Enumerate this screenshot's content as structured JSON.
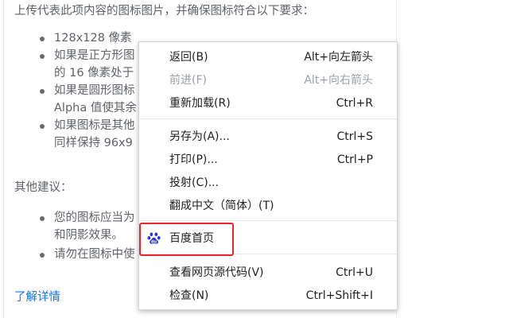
{
  "content": {
    "intro": "上传代表此项内容的图标图片，并确保图标符合以下要求：",
    "requirements": [
      {
        "lines": [
          "128x128 像素"
        ]
      },
      {
        "lines": [
          "如果是正方形图",
          "的 16 像素处于"
        ]
      },
      {
        "lines": [
          "如果是圆形图标",
          "Alpha 值使其余"
        ]
      },
      {
        "lines": [
          "如果图标是其他",
          "同样保持 96x9"
        ]
      }
    ],
    "other_title": "其他建议：",
    "other": [
      {
        "lines": [
          "您的图标应当为",
          "和阴影效果。"
        ]
      },
      {
        "lines": [
          "请勿在图标中使"
        ]
      }
    ],
    "learn_more": "了解详情"
  },
  "context_menu": {
    "items": [
      {
        "label": "返回(B)",
        "shortcut": "Alt+向左箭头",
        "disabled": false
      },
      {
        "label": "前进(F)",
        "shortcut": "Alt+向右箭头",
        "disabled": true
      },
      {
        "label": "重新加载(R)",
        "shortcut": "Ctrl+R",
        "disabled": false
      },
      {
        "label": "另存为(A)...",
        "shortcut": "Ctrl+S",
        "disabled": false
      },
      {
        "label": "打印(P)...",
        "shortcut": "Ctrl+P",
        "disabled": false
      },
      {
        "label": "投射(C)...",
        "shortcut": "",
        "disabled": false
      },
      {
        "label": "翻成中文（简体）(T)",
        "shortcut": "",
        "disabled": false
      },
      {
        "label": "百度首页",
        "shortcut": "",
        "disabled": false,
        "icon": "baidu-paw-icon"
      },
      {
        "label": "查看网页源代码(V)",
        "shortcut": "Ctrl+U",
        "disabled": false
      },
      {
        "label": "检查(N)",
        "shortcut": "Ctrl+Shift+I",
        "disabled": false
      }
    ]
  },
  "colors": {
    "text": "#5f6368",
    "link": "#1a73e8",
    "menu_text": "#202124",
    "menu_disabled": "#9aa0a6",
    "highlight": "#e8262e",
    "baidu_blue": "#2932e1"
  }
}
